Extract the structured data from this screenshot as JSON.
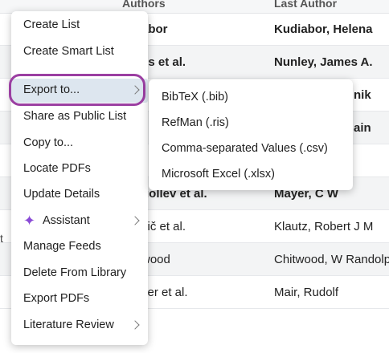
{
  "table": {
    "headers": [
      "Authors",
      "Last Author"
    ],
    "rows": [
      {
        "c1": "abor",
        "c2": "Kudiabor, Helena",
        "bold": true
      },
      {
        "c1": "ss et al.",
        "c2": "Nunley, James A.",
        "bold": true
      },
      {
        "c1": "",
        "c2": "nik",
        "bold": true
      },
      {
        "c1": "",
        "c2": "ain",
        "bold": true
      },
      {
        "c1": "",
        "c2": "",
        "bold": false
      },
      {
        "c1": "gollev et al.",
        "c2": "Mayer, C W",
        "bold": true
      },
      {
        "c1": "šič et al.",
        "c2": "Klautz, Robert J M",
        "bold": false
      },
      {
        "c1": "wood",
        "c2": "Chitwood, W Randolph",
        "bold": false
      },
      {
        "c1": "zer et al.",
        "c2": "Mair, Rudolf",
        "bold": false
      }
    ],
    "edge_text": "t"
  },
  "context_menu": {
    "items": [
      {
        "label": "Create List"
      },
      {
        "label": "Create Smart List"
      },
      {
        "label": "Export to...",
        "submenu": true,
        "highlighted": true
      },
      {
        "label": "Share as Public List"
      },
      {
        "label": "Copy to..."
      },
      {
        "label": "Locate PDFs"
      },
      {
        "label": "Update Details"
      },
      {
        "label": "Assistant",
        "submenu": true,
        "icon": "sparkle-icon"
      },
      {
        "label": "Manage Feeds"
      },
      {
        "label": "Delete From Library"
      },
      {
        "label": "Export PDFs"
      },
      {
        "label": "Literature Review",
        "submenu": true
      }
    ]
  },
  "export_submenu": {
    "items": [
      {
        "label": "BibTeX (.bib)"
      },
      {
        "label": "RefMan (.ris)"
      },
      {
        "label": "Comma-separated Values (.csv)"
      },
      {
        "label": "Microsoft Excel (.xlsx)"
      }
    ]
  },
  "colors": {
    "highlight_ring": "#9b3fa2",
    "highlight_bg": "#dde6ef",
    "sparkle": "#8a4bd6"
  }
}
